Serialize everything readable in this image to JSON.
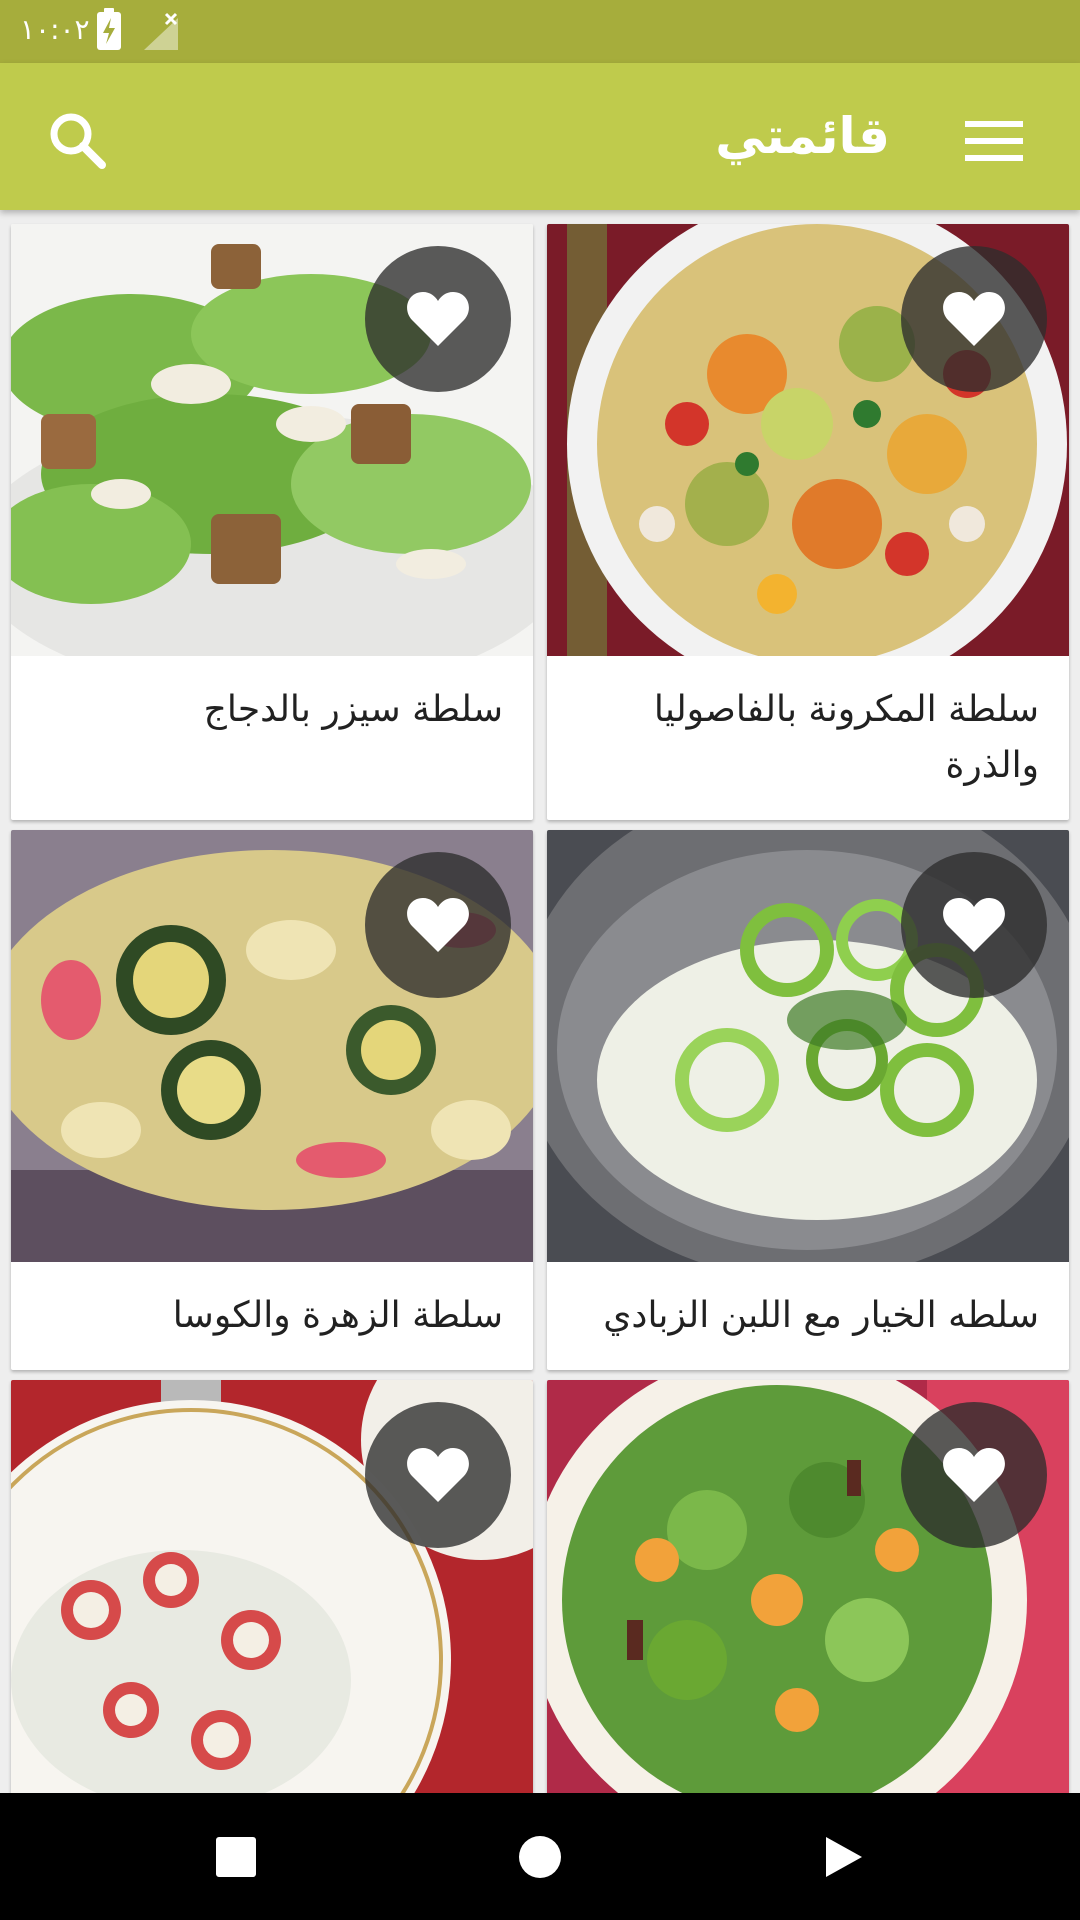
{
  "status_bar": {
    "time": "١٠:٠٢",
    "icons": [
      "battery-charging-icon",
      "signal-none-icon"
    ]
  },
  "app_bar": {
    "title": "قائمتي",
    "icons": [
      "menu-icon",
      "search-icon"
    ]
  },
  "recipes": [
    {
      "title": "سلطة المكرونة بالفاصوليا والذرة",
      "image": "pasta-salad-image",
      "favorite_icon": "heart-icon"
    },
    {
      "title": "سلطة سيزر بالدجاج",
      "image": "caesar-salad-image",
      "favorite_icon": "heart-icon"
    },
    {
      "title": "سلطه الخيار مع اللبن الزبادي",
      "image": "cucumber-yogurt-image",
      "favorite_icon": "heart-icon"
    },
    {
      "title": "سلطة الزهرة والكوسا",
      "image": "cauliflower-zucchini-image",
      "favorite_icon": "heart-icon"
    },
    {
      "title": "",
      "image": "green-salad-image",
      "favorite_icon": "heart-icon"
    },
    {
      "title": "",
      "image": "radish-salad-image",
      "favorite_icon": "heart-icon"
    }
  ],
  "nav_bar": {
    "icons": [
      "recents-icon",
      "home-icon",
      "back-icon"
    ]
  },
  "colors": {
    "status_bar": "#a6ad3c",
    "app_bar": "#bfcb4c",
    "background": "#eeeeee",
    "card": "#ffffff",
    "favorite_circle": "#2d2d2d"
  }
}
